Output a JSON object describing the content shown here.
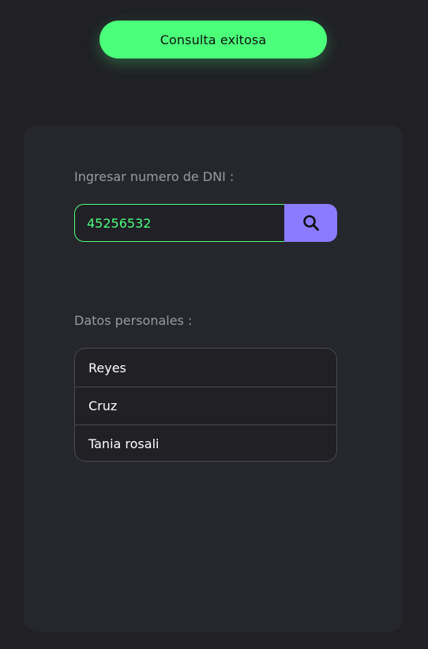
{
  "toast": {
    "message": "Consulta exitosa"
  },
  "search": {
    "label": "Ingresar numero de DNI :",
    "value": "45256532",
    "button_icon": "search-icon"
  },
  "personal_data": {
    "label": "Datos personales :",
    "items": [
      "Reyes",
      "Cruz",
      "Tania rosali"
    ]
  },
  "colors": {
    "accent_green": "#4bff7a",
    "accent_purple": "#8b7bff",
    "background": "#202025",
    "card": "#26262d"
  }
}
